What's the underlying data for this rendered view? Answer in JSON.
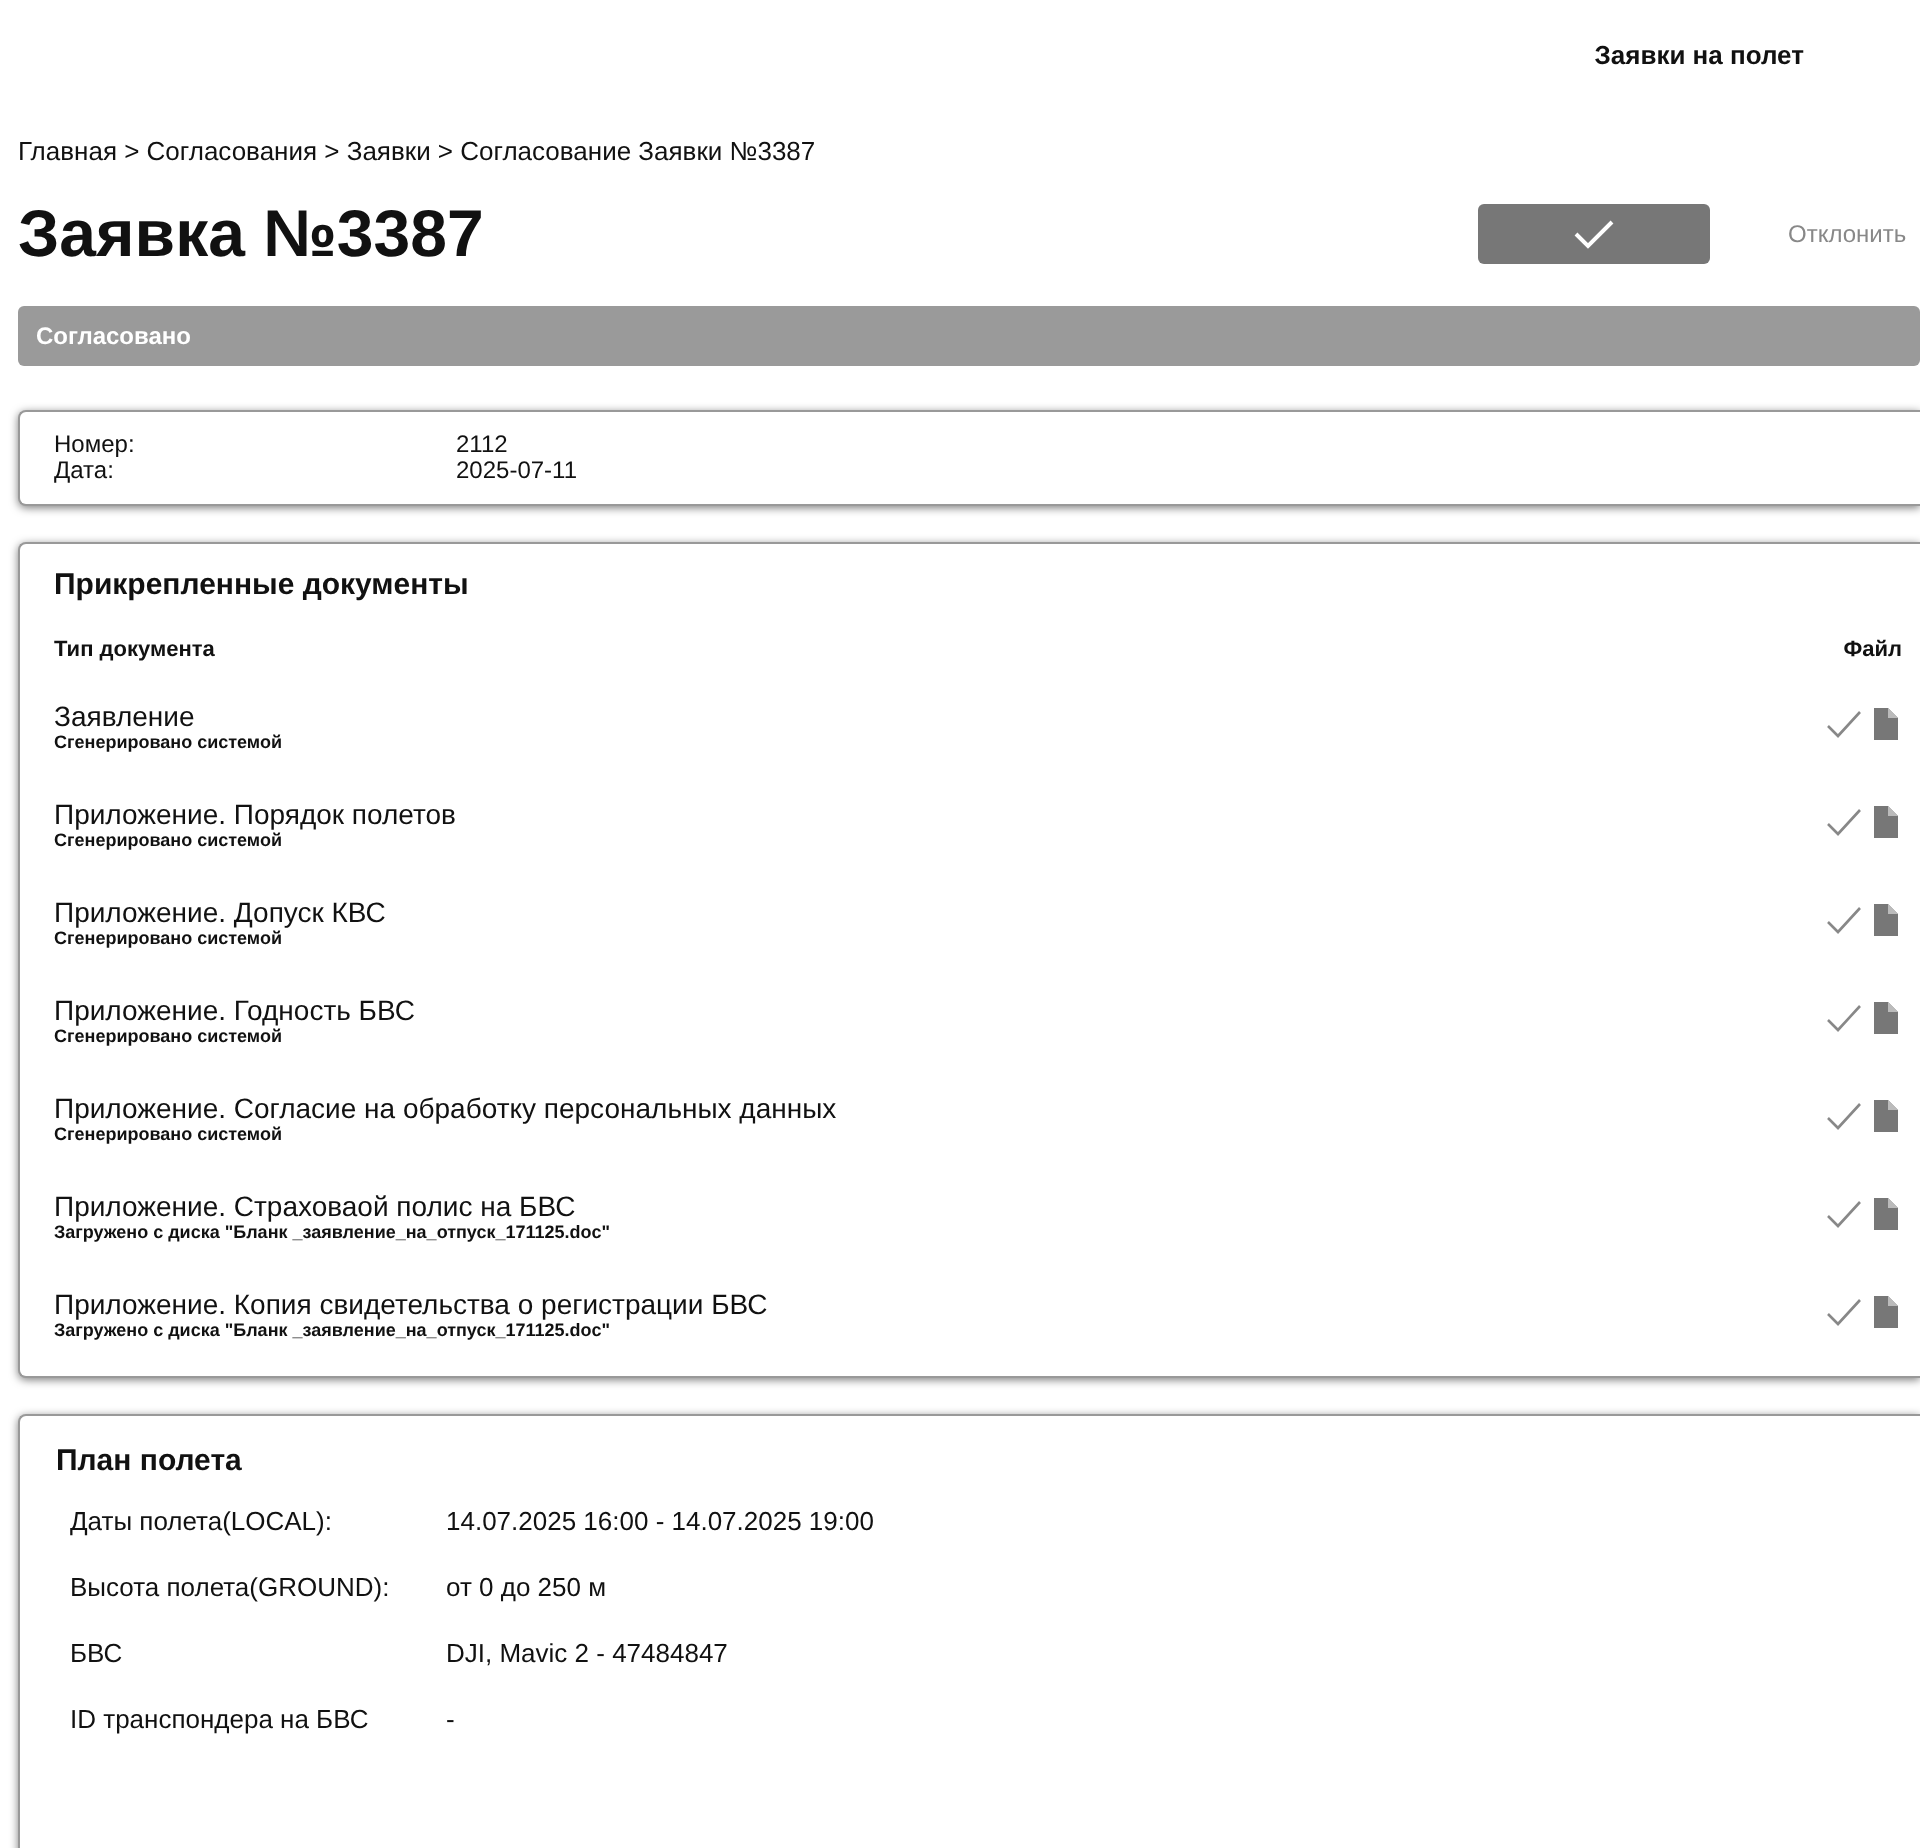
{
  "header": {
    "title": "Заявки на полет"
  },
  "breadcrumb": "Главная > Согласования > Заявки > Согласование Заявки №3387",
  "title": "Заявка №3387",
  "actions": {
    "reject": "Отклонить"
  },
  "status": "Согласовано",
  "info": [
    {
      "label": "Номер:",
      "value": "2112"
    },
    {
      "label": "Дата:",
      "value": "2025-07-11"
    }
  ],
  "documents": {
    "title": "Прикрепленные документы",
    "columns": [
      "Тип документа",
      "Файл"
    ],
    "rows": [
      {
        "name": "Заявление",
        "source": "Сгенерировано системой",
        "checked": true
      },
      {
        "name": "Приложение. Порядок полетов",
        "source": "Сгенерировано системой",
        "checked": true
      },
      {
        "name": "Приложение. Допуск КВС",
        "source": "Сгенерировано системой",
        "checked": true
      },
      {
        "name": "Приложение. Годность БВС",
        "source": "Сгенерировано системой",
        "checked": true
      },
      {
        "name": "Приложение. Согласие на обработку персональных данных",
        "source": "Сгенерировано системой",
        "checked": true
      },
      {
        "name": "Приложение. Страховаой полис на БВС",
        "source": "Загружено с диска \"Бланк _заявление_на_отпуск_171125.doc\"",
        "checked": true
      },
      {
        "name": "Приложение. Копия свидетельства о регистрации БВС",
        "source": "Загружено с диска \"Бланк _заявление_на_отпуск_171125.doc\"",
        "checked": true
      }
    ]
  },
  "flight_plan": {
    "title": "План полета",
    "rows": [
      {
        "label": "Даты полета(LOCAL):",
        "value": "14.07.2025 16:00 - 14.07.2025 19:00"
      },
      {
        "label": "Высота полета(GROUND):",
        "value": "от 0 до 250 м"
      },
      {
        "label": "БВС",
        "value": "DJI, Mavic 2 - 47484847"
      },
      {
        "label": "ID транспондера на БВС",
        "value": "-"
      }
    ]
  }
}
